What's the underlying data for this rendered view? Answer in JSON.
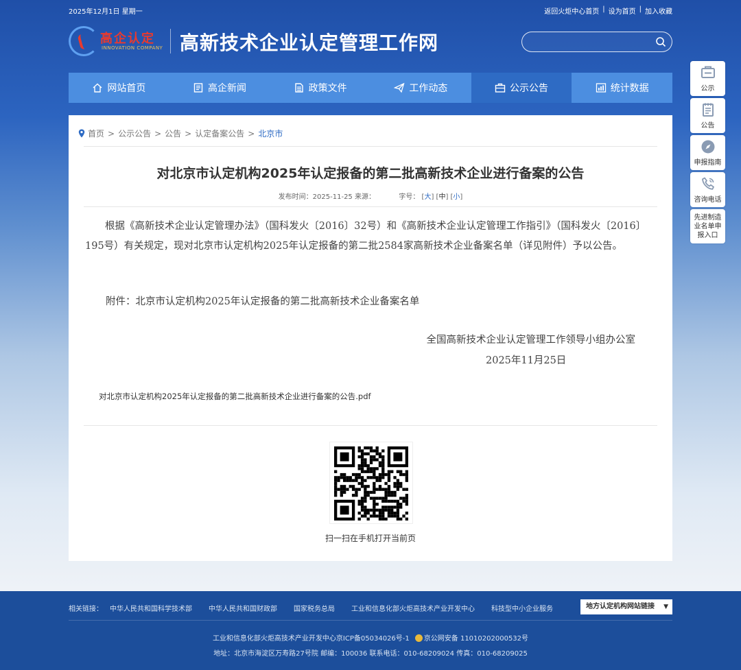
{
  "top_bar": {
    "date": "2025年12月1日 星期一",
    "links": [
      "返回火炬中心首页",
      "设为首页",
      "加入收藏"
    ]
  },
  "logo": {
    "brand_cn": "高企认定",
    "brand_en": "INNOVATION COMPANY",
    "site_name": "高新技术企业认定管理工作网"
  },
  "search": {
    "placeholder": ""
  },
  "nav": [
    {
      "label": "网站首页",
      "icon": "home-icon"
    },
    {
      "label": "高企新闻",
      "icon": "news-icon"
    },
    {
      "label": "政策文件",
      "icon": "document-icon"
    },
    {
      "label": "工作动态",
      "icon": "paper-plane-icon"
    },
    {
      "label": "公示公告",
      "icon": "briefcase-icon",
      "active": true
    },
    {
      "label": "统计数据",
      "icon": "chart-icon"
    }
  ],
  "breadcrumb": [
    "首页",
    "公示公告",
    "公告",
    "认定备案公告",
    "北京市"
  ],
  "article": {
    "title": "对北京市认定机构2025年认定报备的第二批高新技术企业进行备案的公告",
    "meta_date_label": "发布时间：",
    "meta_date": "2025-11-25",
    "meta_source_label": "来源：",
    "meta_size_label": "字号：",
    "size_large": "大",
    "size_medium": "中",
    "size_small": "小",
    "paragraph": "根据《高新技术企业认定管理办法》（国科发火〔2016〕32号）和《高新技术企业认定管理工作指引》（国科发火〔2016〕195号）有关规定，现对北京市认定机构2025年认定报备的第二批2584家高新技术企业备案名单（详见附件）予以公告。",
    "attachment": "附件：北京市认定机构2025年认定报备的第二批高新技术企业备案名单",
    "sign_org": "全国高新技术企业认定管理工作领导小组办公室",
    "sign_date": "2025年11月25日",
    "pdf_link": "对北京市认定机构2025年认定报备的第二批高新技术企业进行备案的公告.pdf",
    "qr_caption": "扫一扫在手机打开当前页"
  },
  "side_buttons": [
    {
      "label": "公示",
      "icon": "board-icon"
    },
    {
      "label": "公告",
      "icon": "notepad-icon"
    },
    {
      "label": "申报指南",
      "icon": "compass-icon"
    },
    {
      "label": "咨询电话",
      "icon": "phone-icon"
    },
    {
      "label": "先进制造业名单申报入口",
      "icon": ""
    }
  ],
  "footer": {
    "links_label": "相关链接：",
    "links": [
      "中华人民共和国科学技术部",
      "中华人民共和国财政部",
      "国家税务总局",
      "工业和信息化部火炬高技术产业开发中心",
      "科技型中小企业服务"
    ],
    "dropdown": "地方认定机构网站链接",
    "icp": "工业和信息化部火炬高技术产业开发中心京ICP备05034026号-1",
    "police": "京公网安备 11010202000532号",
    "address": "地址：北京市海淀区万寿路27号院 邮编：100036 联系电话：010-68209024 传真：010-68209025"
  }
}
